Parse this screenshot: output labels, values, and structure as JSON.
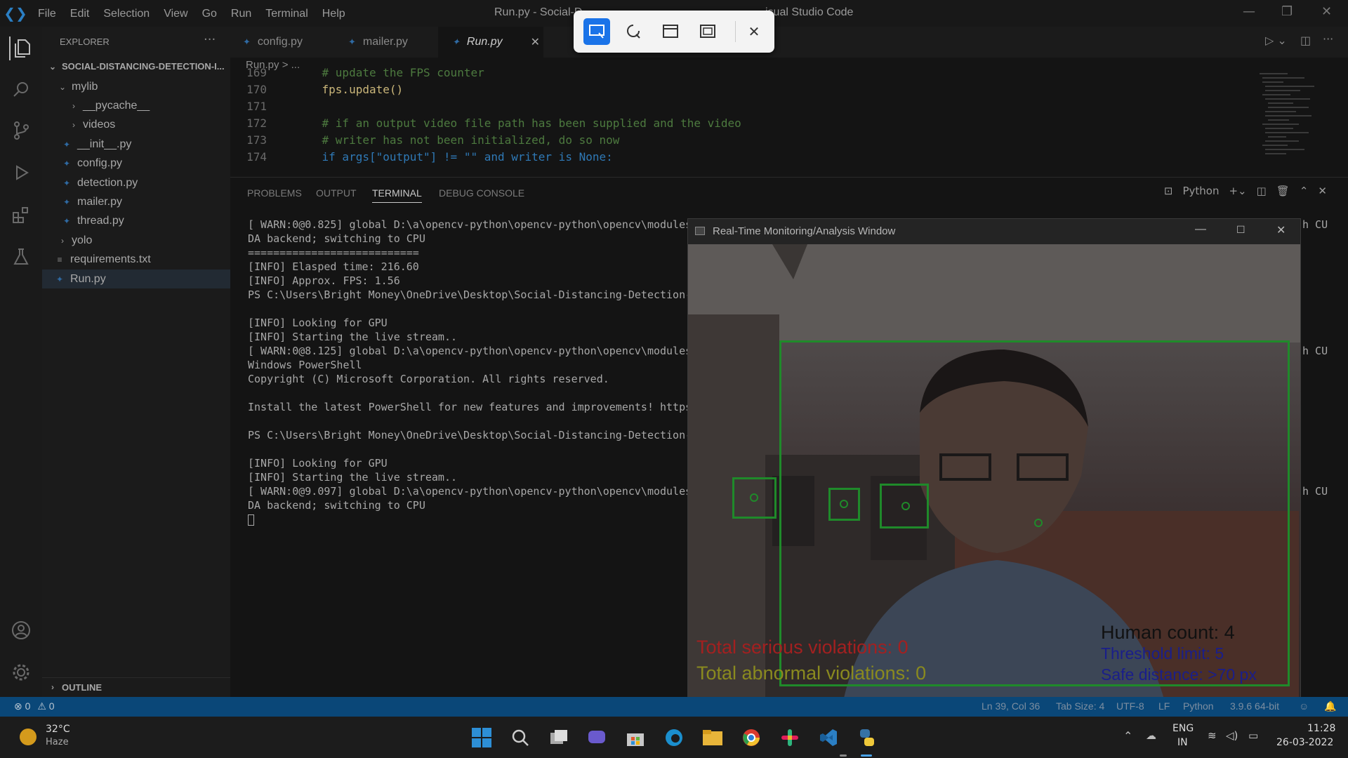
{
  "titlebar": {
    "menu": [
      "File",
      "Edit",
      "Selection",
      "View",
      "Go",
      "Run",
      "Terminal",
      "Help"
    ],
    "title": "Run.py - Social-D",
    "title_tail": "isual Studio Code"
  },
  "sidebar": {
    "header": "EXPLORER",
    "root": "SOCIAL-DISTANCING-DETECTION-I...",
    "items": [
      {
        "label": "mylib",
        "kind": "folder-open"
      },
      {
        "label": "__pycache__",
        "kind": "folder"
      },
      {
        "label": "videos",
        "kind": "folder"
      },
      {
        "label": "__init__.py",
        "kind": "file"
      },
      {
        "label": "config.py",
        "kind": "file"
      },
      {
        "label": "detection.py",
        "kind": "file"
      },
      {
        "label": "mailer.py",
        "kind": "file"
      },
      {
        "label": "thread.py",
        "kind": "file"
      },
      {
        "label": "yolo",
        "kind": "folder"
      },
      {
        "label": "requirements.txt",
        "kind": "text"
      },
      {
        "label": "Run.py",
        "kind": "file"
      }
    ],
    "outline": "OUTLINE"
  },
  "tabs": [
    "config.py",
    "mailer.py",
    "Run.py"
  ],
  "breadcrumb": "Run.py > ...",
  "code": [
    {
      "n": "169",
      "t": "    # update the FPS counter"
    },
    {
      "n": "170",
      "t": "    fps.update()"
    },
    {
      "n": "171",
      "t": ""
    },
    {
      "n": "172",
      "t": "    # if an output video file path has been supplied and the video"
    },
    {
      "n": "173",
      "t": "    # writer has not been initialized, do so now"
    },
    {
      "n": "174",
      "t": "    if args[\"output\"] != \"\" and writer is None:"
    }
  ],
  "panel": {
    "tabs": [
      "PROBLEMS",
      "OUTPUT",
      "TERMINAL",
      "DEBUG CONSOLE"
    ],
    "shell": "Python"
  },
  "terminal": [
    "[ WARN:0@0.825] global D:\\a\\opencv-python\\opencv-python\\opencv\\modules",
    "DA backend; switching to CPU",
    "===========================",
    "[INFO] Elasped time: 216.60",
    "[INFO] Approx. FPS: 1.56",
    "PS C:\\Users\\Bright Money\\OneDrive\\Desktop\\Social-Distancing-Detection-",
    "",
    "[INFO] Looking for GPU",
    "[INFO] Starting the live stream..",
    "[ WARN:0@8.125] global D:\\a\\opencv-python\\opencv-python\\opencv\\modules",
    "Windows PowerShell",
    "Copyright (C) Microsoft Corporation. All rights reserved.",
    "",
    "Install the latest PowerShell for new features and improvements! https",
    "",
    "PS C:\\Users\\Bright Money\\OneDrive\\Desktop\\Social-Distancing-Detection-",
    "",
    "[INFO] Looking for GPU",
    "[INFO] Starting the live stream..",
    "[ WARN:0@9.097] global D:\\a\\opencv-python\\opencv-python\\opencv\\modules",
    "DA backend; switching to CPU"
  ],
  "terminal_right": [
    "h CU",
    "h CU",
    "h CU"
  ],
  "monitor": {
    "title": "Real-Time Monitoring/Analysis Window",
    "serious": "Total serious violations: 0",
    "abnormal": "Total abnormal violations: 0",
    "count": "Human count: 4",
    "threshold": "Threshold limit: 5",
    "safe": "Safe distance: >70 px"
  },
  "status": {
    "errors": "0",
    "warnings": "0",
    "right": [
      "Ln 39, Col 36",
      "Tab Size: 4",
      "UTF-8",
      "LF",
      "Python",
      "3.9.6 64-bit"
    ]
  },
  "taskbar": {
    "temp": "32°C",
    "weather": "Haze",
    "lang1": "ENG",
    "lang2": "IN",
    "time": "11:28",
    "date": "26-03-2022"
  }
}
